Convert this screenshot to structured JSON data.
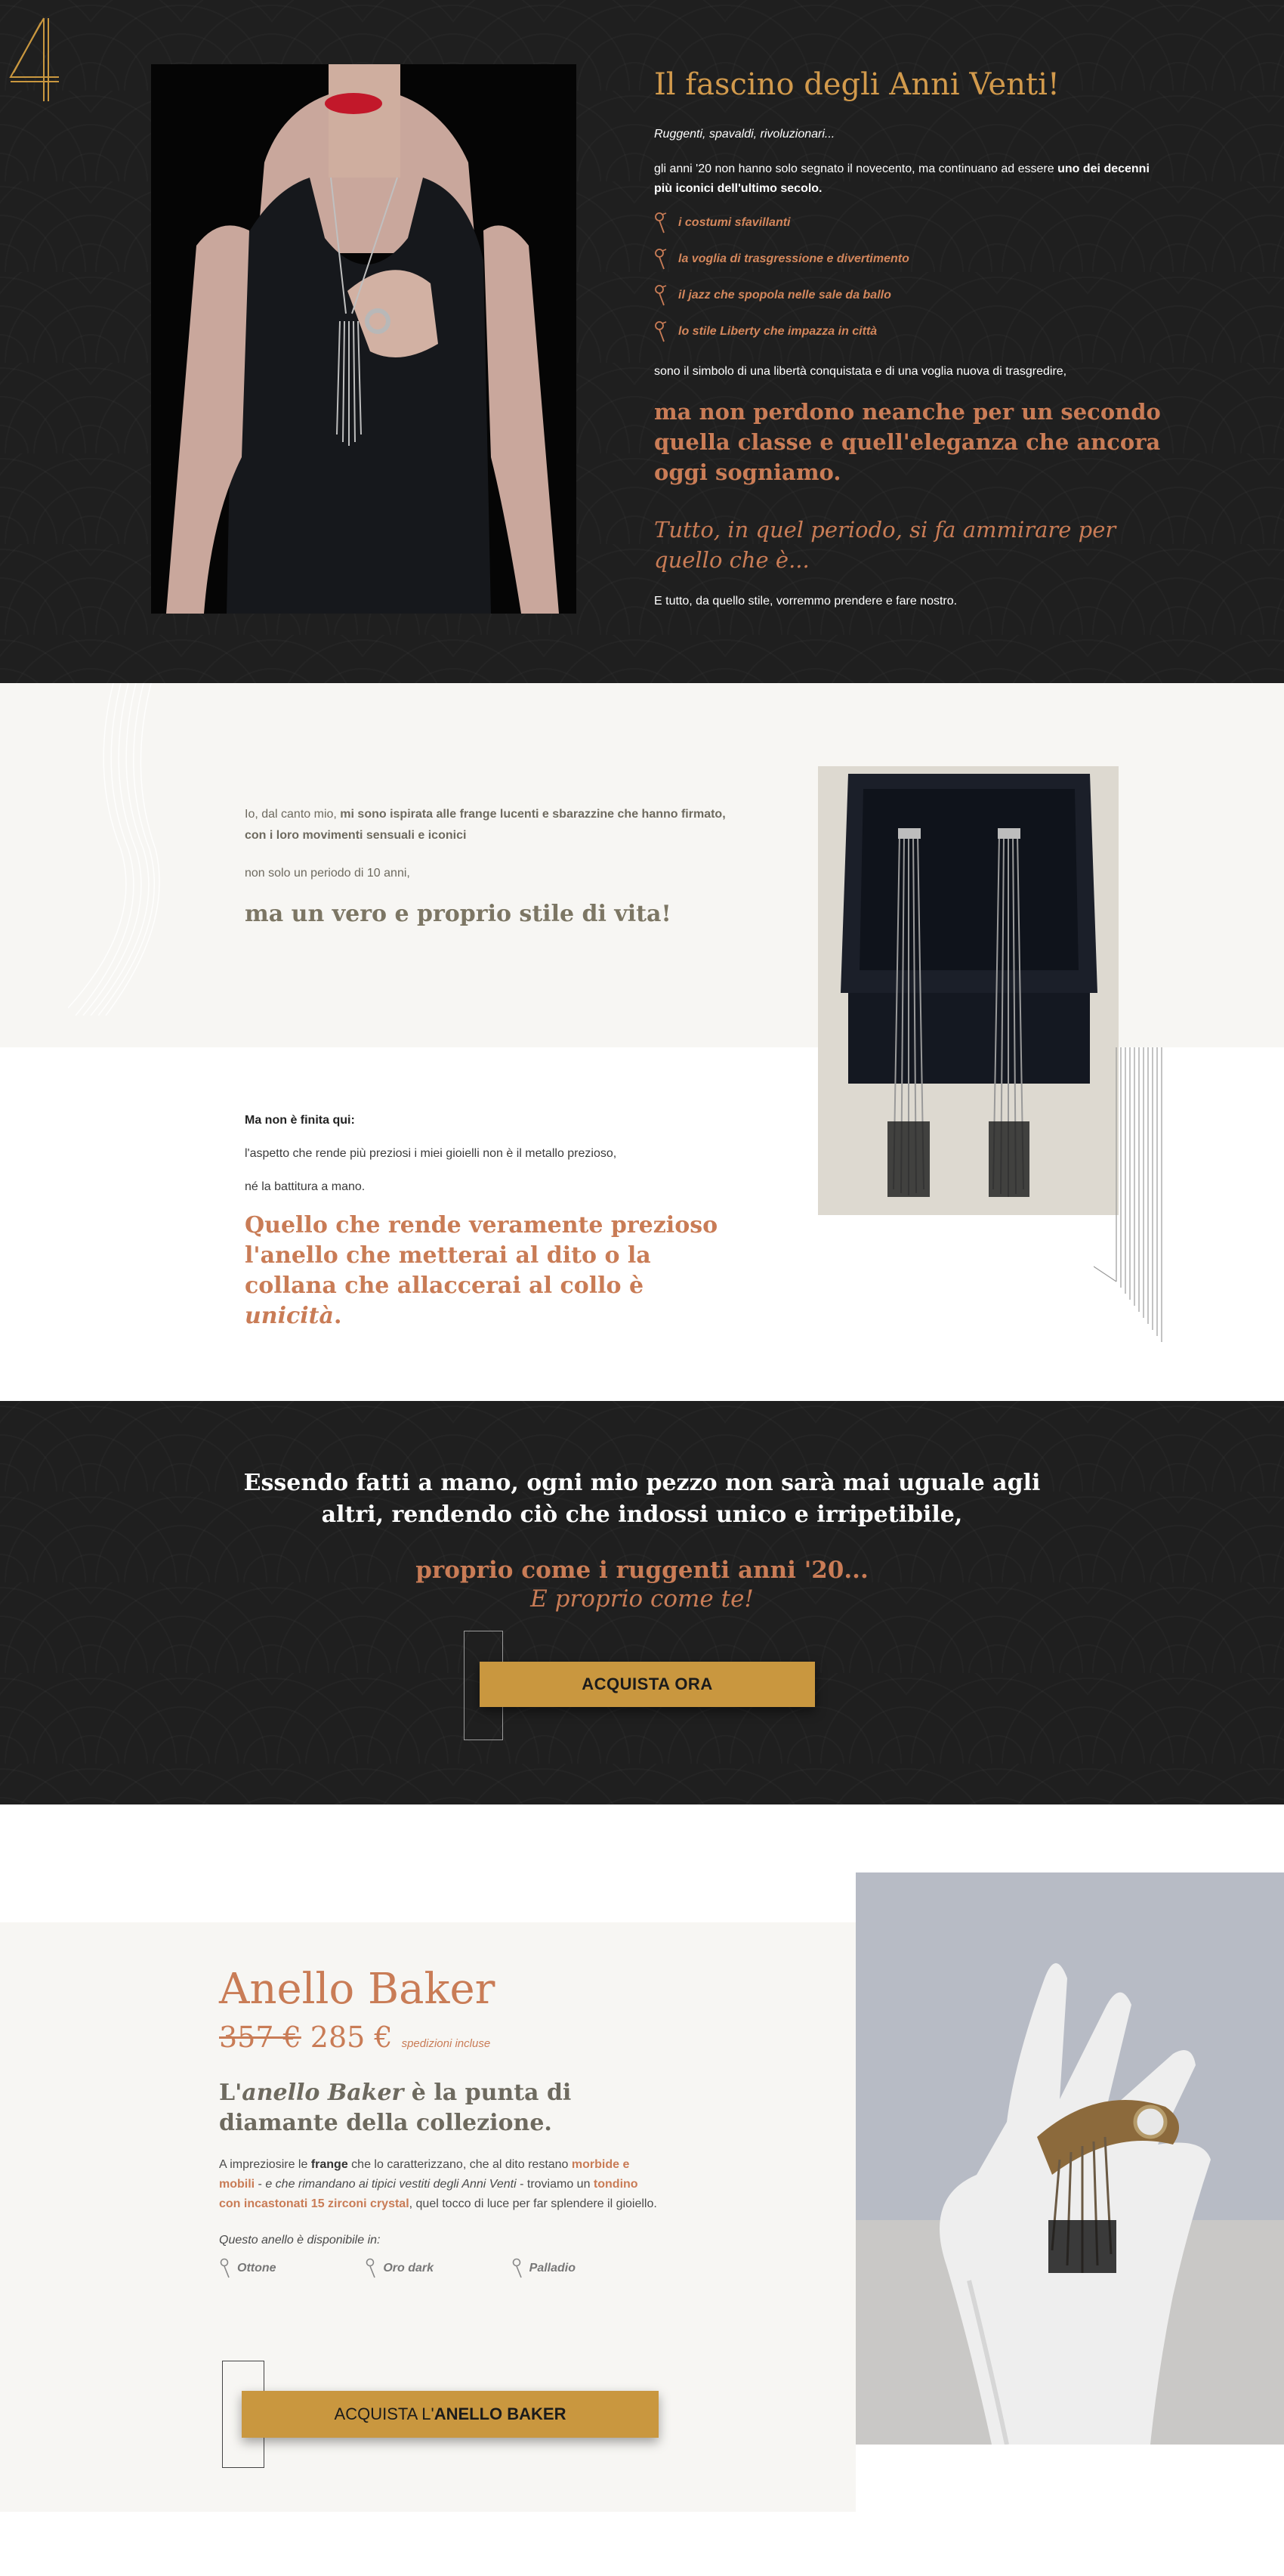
{
  "section1": {
    "number_logo": "4",
    "title": "Il fascino degli Anni Venti!",
    "intro": "Ruggenti, spavaldi, rivoluzionari...",
    "p1_regular": "gli anni '20 non hanno solo segnato il novecento, ma continuano ad essere ",
    "p1_bold": "uno dei decenni più iconici dell'ultimo secolo.",
    "list": [
      "i costumi sfavillanti",
      "la voglia di trasgressione e divertimento",
      "il jazz che spopola nelle sale da ballo",
      "lo stile Liberty che impazza in città"
    ],
    "p2": "sono il simbolo di una libertà conquistata e di una voglia nuova di trasgredire,",
    "big_quote": "ma non perdono neanche per un secondo quella classe e quell'eleganza che ancora oggi sogniamo.",
    "italic_quote": "Tutto, in quel periodo, si fa ammirare per quello che è...",
    "final": "E tutto, da quello stile, vorremmo prendere e fare nostro."
  },
  "section2": {
    "p1_regular": "Io, dal canto mio, ",
    "p1_bold": "mi sono ispirata alle frange lucenti e sbarazzine che hanno firmato, con i loro movimenti sensuali e iconici",
    "p2": "non solo un periodo di 10 anni,",
    "big_text": "ma un vero e proprio stile di vita!",
    "head": "Ma non è finita qui:",
    "p3": "l'aspetto che rende più preziosi i miei gioielli non è il metallo prezioso,",
    "p4": "né la battitura a mano.",
    "quote_main": "Quello che rende veramente prezioso l'anello che metterai al dito o la collana che allaccerai al collo è ",
    "quote_italic": "unicità",
    "quote_end": "."
  },
  "section3": {
    "white_text": "Essendo fatti a mano, ogni mio pezzo non sarà mai uguale agli altri, rendendo ciò che indossi unico e irripetibile,",
    "orange_line1": "proprio come i ruggenti anni '20...",
    "orange_line2": "E proprio come te!",
    "button_label": "ACQUISTA ORA"
  },
  "section4": {
    "title": "Anello Baker",
    "old_price": "357 €",
    "new_price": "285 €",
    "shipping": "spedizioni incluse",
    "sub_prefix": "L'",
    "sub_italic": "anello Baker",
    "sub_rest": " è la punta di diamante della collezione.",
    "desc": {
      "t1": "A impreziosire le ",
      "b1": "frange",
      "t2": " che lo caratterizzano, che al dito restano ",
      "a1": "morbide e mobili",
      "t3": " - ",
      "i1": "e che rimandano ai tipici vestiti degli Anni Venti",
      "t4": " - troviamo un ",
      "a2": "tondino con incastonati 15 zirconi crystal",
      "t5": ", quel tocco di luce per far splendere il gioiello."
    },
    "available": "Questo anello è disponibile in:",
    "variants": [
      "Ottone",
      "Oro dark",
      "Palladio"
    ],
    "button_prefix": "ACQUISTA L'",
    "button_bold": "ANELLO BAKER"
  },
  "colors": {
    "dark_bg": "#1f1f1f",
    "gold": "#d29a4c",
    "copper": "#c97c56",
    "button": "#c9973f",
    "light_band": "#f7f6f3"
  }
}
